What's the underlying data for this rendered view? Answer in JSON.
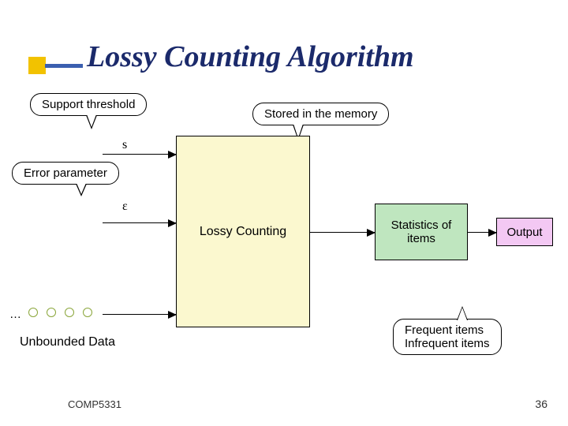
{
  "title": "Lossy Counting Algorithm",
  "callouts": {
    "support": "Support threshold",
    "stored": "Stored in the memory",
    "error": "Error parameter",
    "freq_line1": "Frequent items",
    "freq_line2": "Infrequent items"
  },
  "params": {
    "s": "s",
    "eps": "ε",
    "dots": "…"
  },
  "labels": {
    "unbounded": "Unbounded Data"
  },
  "boxes": {
    "lossy": "Lossy Counting",
    "stats_line1": "Statistics of",
    "stats_line2": "items",
    "output": "Output"
  },
  "footer": {
    "course": "COMP5331",
    "page": "36"
  }
}
